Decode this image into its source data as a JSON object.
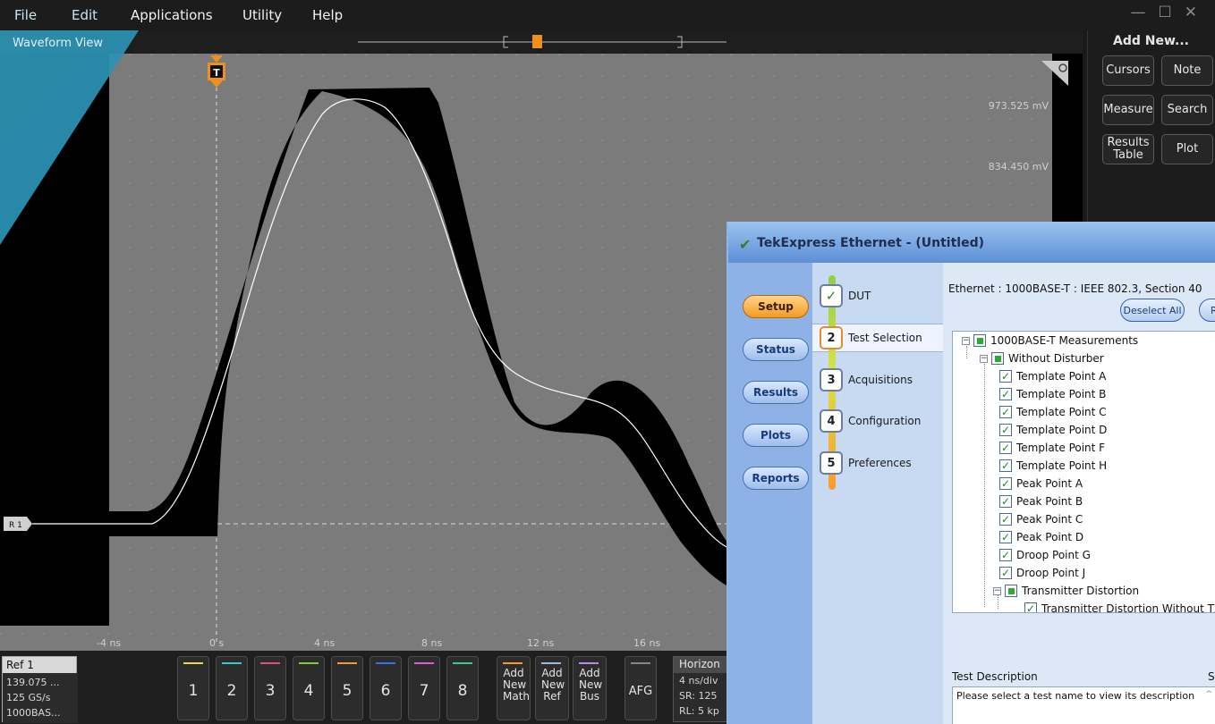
{
  "menubar": {
    "items": [
      "File",
      "Edit",
      "Applications",
      "Utility",
      "Help"
    ]
  },
  "waveform": {
    "title": "Waveform View",
    "trigger_label": "T",
    "ref_marker": "R 1",
    "volt_labels": [
      "973.525 mV",
      "834.450 mV"
    ],
    "time_ticks": [
      "-4 ns",
      "0 s",
      "4 ns",
      "8 ns",
      "12 ns",
      "16 ns"
    ]
  },
  "add_new": {
    "title": "Add New...",
    "buttons": [
      "Cursors",
      "Note",
      "Measure",
      "Search",
      "Results Table",
      "Plot"
    ]
  },
  "ref_box": {
    "title": "Ref 1",
    "lines": [
      "139.075 ...",
      "125 GS/s",
      "1000BAS..."
    ]
  },
  "channels": [
    {
      "label": "1",
      "color": "#e8d84a"
    },
    {
      "label": "2",
      "color": "#3ec6d8"
    },
    {
      "label": "3",
      "color": "#e0507a"
    },
    {
      "label": "4",
      "color": "#7ccf3a"
    },
    {
      "label": "5",
      "color": "#f39a2a"
    },
    {
      "label": "6",
      "color": "#3a6fe0"
    },
    {
      "label": "7",
      "color": "#e05ad8"
    },
    {
      "label": "8",
      "color": "#3ec88a"
    }
  ],
  "add_channels": [
    {
      "label": "Add New Math",
      "color": "#f39a2a"
    },
    {
      "label": "Add New Ref",
      "color": "#9ab8e8"
    },
    {
      "label": "Add New Bus",
      "color": "#b88ae0"
    }
  ],
  "afg_label": "AFG",
  "horizontal": {
    "title": "Horizon",
    "lines": [
      "4 ns/div",
      "SR: 125",
      "RL: 5 kp"
    ]
  },
  "tek": {
    "title": "TekExpress Ethernet  - (Untitled)",
    "nav": [
      "Setup",
      "Status",
      "Results",
      "Plots",
      "Reports"
    ],
    "steps": [
      {
        "num": "✓",
        "label": "DUT"
      },
      {
        "num": "2",
        "label": "Test Selection"
      },
      {
        "num": "3",
        "label": "Acquisitions"
      },
      {
        "num": "4",
        "label": "Configuration"
      },
      {
        "num": "5",
        "label": "Preferences"
      }
    ],
    "standard": "Ethernet : 1000BASE-T : IEEE 802.3, Section 40",
    "deselect_all": "Deselect All",
    "r_button": "R",
    "tree": {
      "root": "1000BASE-T Measurements",
      "group1": "Without Disturber",
      "items": [
        "Template Point A",
        "Template Point B",
        "Template Point C",
        "Template Point D",
        "Template Point F",
        "Template Point H",
        "Peak Point A",
        "Peak Point B",
        "Peak Point C",
        "Peak Point D",
        "Droop Point G",
        "Droop Point J"
      ],
      "group2": "Transmitter Distortion",
      "sub_item": "Transmitter Distortion Without TX_T"
    },
    "desc_label": "Test Description",
    "desc_right": "S",
    "desc_text": "Please select a test name to view its description"
  }
}
